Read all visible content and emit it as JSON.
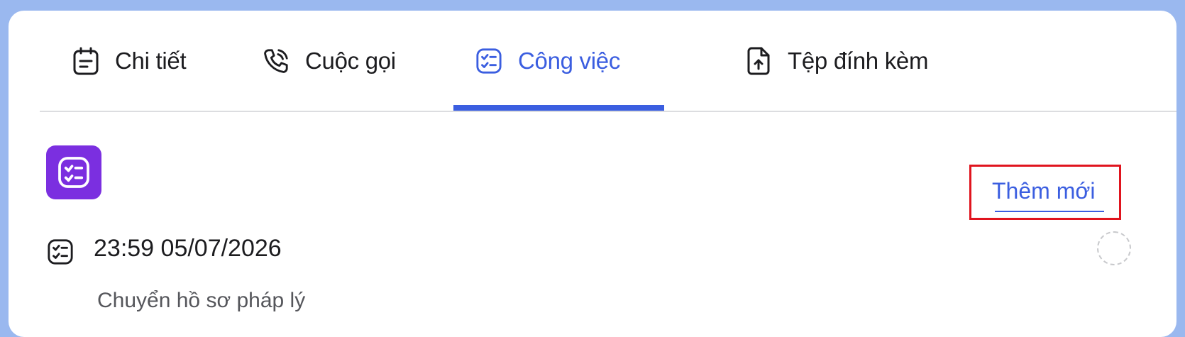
{
  "tabs": [
    {
      "label": "Chi tiết",
      "icon": "calendar-note-icon",
      "active": false
    },
    {
      "label": "Cuộc gọi",
      "icon": "phone-call-icon",
      "active": false
    },
    {
      "label": "Công việc",
      "icon": "task-list-icon",
      "active": true
    },
    {
      "label": "Tệp đính kèm",
      "icon": "file-upload-icon",
      "active": false
    }
  ],
  "section": {
    "icon": "task-list-icon",
    "add_label": "Thêm mới"
  },
  "task": {
    "icon": "task-list-icon",
    "due": "23:59 05/07/2026",
    "title": "Chuyển hồ sơ pháp lý",
    "status": "incomplete"
  },
  "colors": {
    "background": "#9ab8ef",
    "accent": "#3b5ee0",
    "badge": "#7b2fe0",
    "highlight": "#e0141e"
  }
}
